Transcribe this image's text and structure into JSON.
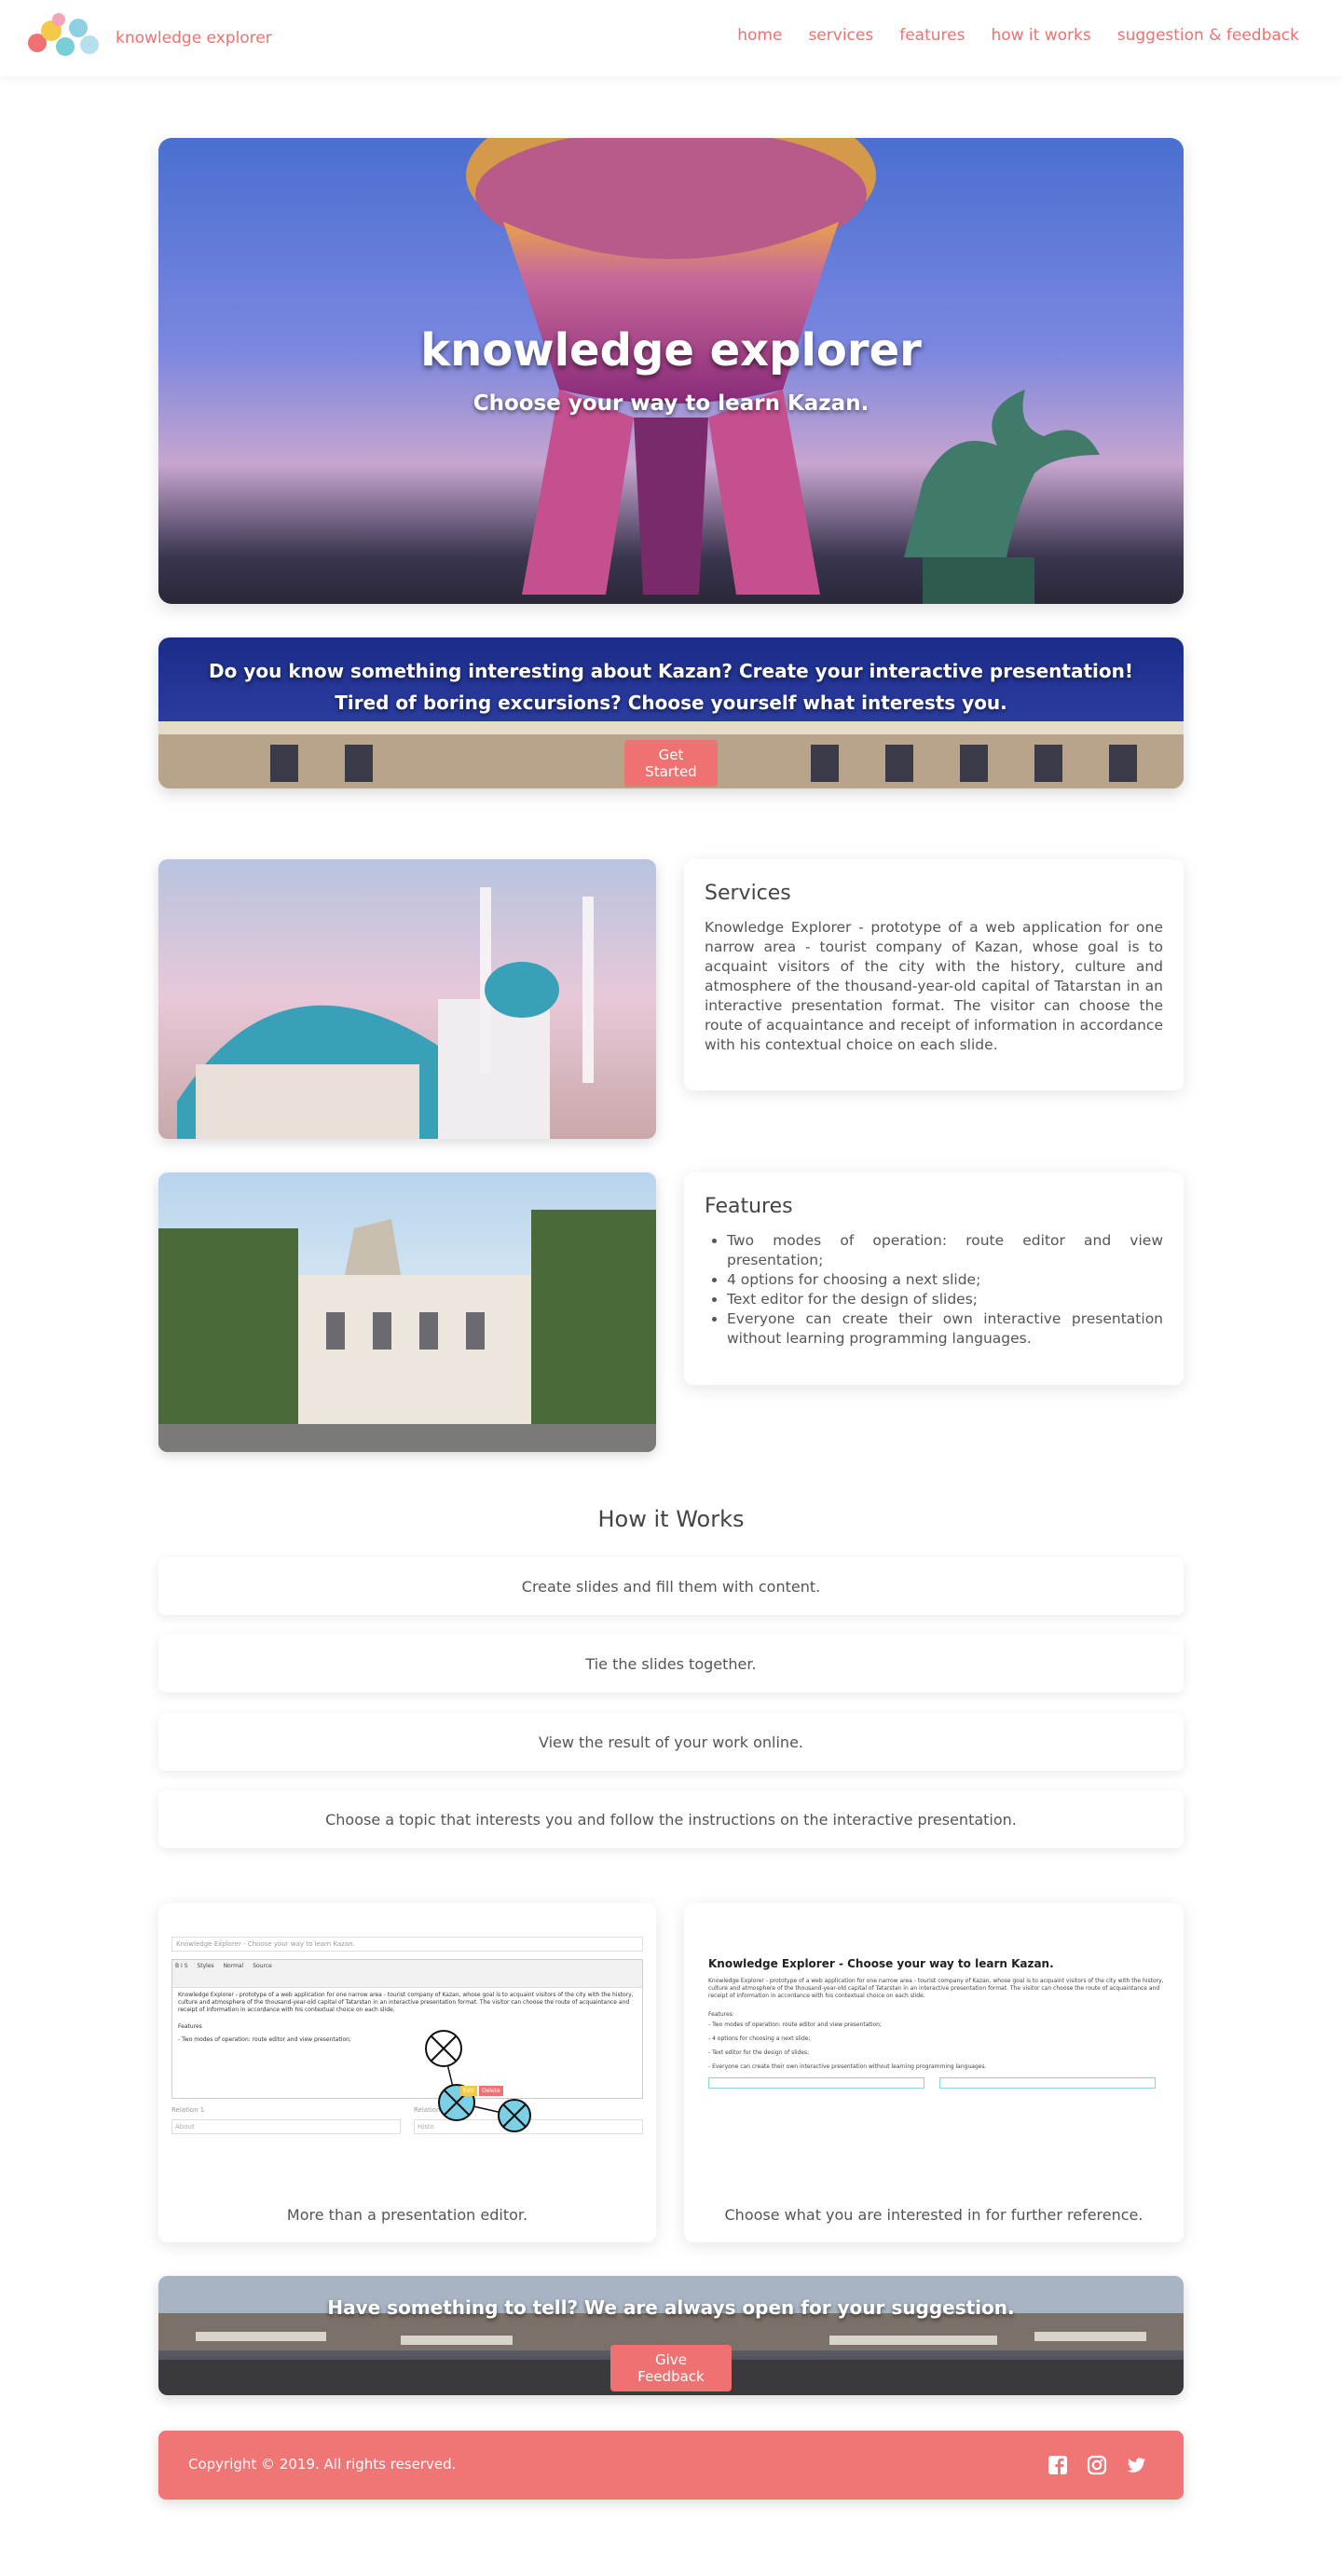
{
  "nav": {
    "brand": "knowledge explorer",
    "links": [
      "home",
      "services",
      "features",
      "how it works",
      "suggestion & feedback"
    ]
  },
  "hero": {
    "title": "knowledge explorer",
    "subtitle": "Choose your way to learn Kazan."
  },
  "cta": {
    "line1": "Do you know something interesting about Kazan? Create your interactive presentation!",
    "line2": "Tired of boring excursions? Choose yourself what interests you.",
    "button": "Get Started"
  },
  "services": {
    "title": "Services",
    "text": "Knowledge Explorer - prototype of a web application for one narrow area - tourist company of Kazan, whose goal is to acquaint visitors of the city with the history, culture and atmosphere of the thousand-year-old capital of Tatarstan in an interactive presentation format. The visitor can choose the route of acquaintance and receipt of information in accordance with his contextual choice on each slide."
  },
  "features": {
    "title": "Features",
    "items": [
      "Two modes of operation: route editor and view presentation;",
      "4 options for choosing a next slide;",
      "Text editor for the design of slides;",
      "Everyone can create their own interactive presentation without learning programming languages."
    ]
  },
  "how": {
    "title": "How it Works",
    "steps": [
      "Create slides and fill them with content.",
      "Tie the slides together.",
      "View the result of your work online.",
      "Choose a topic that interests you and follow the instructions on the interactive presentation."
    ]
  },
  "screens": {
    "editor": {
      "caption": "More than a presentation editor.",
      "title_placeholder": "Knowledge Explorer - Choose your way to learn Kazan.",
      "editor_text": "Knowledge Explorer - prototype of a web application for one narrow area - tourist company of Kazan, whose goal is to acquaint visitors of the city with the history, culture and atmosphere of the thousand-year-old capital of Tatarstan in an interactive presentation format. The visitor can choose the route of acquaintance and receipt of information in accordance with his contextual choice on each slide.",
      "editor_features": "Features",
      "editor_item": "- Two modes of operation: route editor and view presentation;",
      "relation1": "Relation 1",
      "relation2": "Relation 2",
      "field1": "About",
      "field2": "Histo",
      "edit": "Edit",
      "delete": "Delete",
      "source": "Source",
      "styles": "Styles",
      "normal": "Normal"
    },
    "viewer": {
      "caption": "Choose what you are interested in for further reference.",
      "title": "Knowledge Explorer - Choose your way to learn Kazan.",
      "text": "Knowledge Explorer - prototype of a web application for one narrow area - tourist company of Kazan, whose goal is to acquaint visitors of the city with the history, culture and atmosphere of the thousand-year-old capital of Tatarstan in an interactive presentation format. The visitor can choose the route of acquaintance and receipt of information in accordance with his contextual choice on each slide.",
      "features_label": "Features:",
      "items": [
        "- Two modes of operation: route editor and view presentation;",
        "- 4 options for choosing a next slide;",
        "- Text editor for the design of slides;",
        "- Everyone can create their own interactive presentation without learning programming languages."
      ]
    }
  },
  "feedback": {
    "text": "Have something to tell? We are always open for your suggestion.",
    "button": "Give Feedback"
  },
  "footer": {
    "copyright": "Copyright © 2019. All rights reserved.",
    "social": [
      "facebook-icon",
      "instagram-icon",
      "twitter-icon"
    ]
  },
  "colors": {
    "accent": "#f07171",
    "text": "#555555"
  }
}
